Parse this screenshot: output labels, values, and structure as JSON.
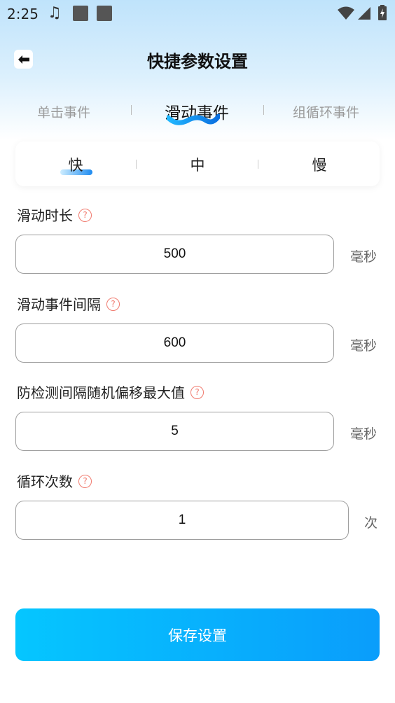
{
  "status_bar": {
    "time": "2:25",
    "icons": [
      "music-note-icon",
      "notification-square-icon",
      "notification-square-icon",
      "wifi-icon",
      "signal-icon",
      "battery-charging-icon"
    ]
  },
  "header": {
    "title": "快捷参数设置",
    "back_icon": "arrow-left-icon"
  },
  "tabs": [
    {
      "label": "单击事件",
      "active": false
    },
    {
      "label": "滑动事件",
      "active": true
    },
    {
      "label": "组循环事件",
      "active": false
    }
  ],
  "speed": {
    "options": [
      "快",
      "中",
      "慢"
    ],
    "selected": "快"
  },
  "fields": [
    {
      "label": "滑动时长",
      "value": "500",
      "unit": "毫秒"
    },
    {
      "label": "滑动事件间隔",
      "value": "600",
      "unit": "毫秒"
    },
    {
      "label": "防检测间隔随机偏移最大值",
      "value": "5",
      "unit": "毫秒"
    },
    {
      "label": "循环次数",
      "value": "1",
      "unit": "次"
    }
  ],
  "help_icon_glyph": "?",
  "save_button": "保存设置",
  "colors": {
    "accent_start": "#05c6ff",
    "accent_end": "#0a9dfb",
    "help_icon": "#f07a6e",
    "header_gradient": "#bfe3fb"
  }
}
